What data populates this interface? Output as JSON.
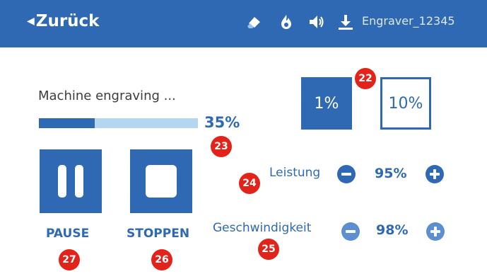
{
  "header": {
    "back_label": "Zurück",
    "device_name": "Engraver_12345",
    "icons": [
      "eraser-icon",
      "flame-icon",
      "speaker-icon",
      "download-icon"
    ]
  },
  "job": {
    "status": "Machine engraving ...",
    "progress_percent": 35,
    "progress_label": "35%"
  },
  "controls": {
    "pause_label": "PAUSE",
    "stop_label": "STOPPEN"
  },
  "step": {
    "small_label": "1%",
    "large_label": "10%"
  },
  "params": {
    "power": {
      "label": "Leistung",
      "value": "95%"
    },
    "speed": {
      "label": "Geschwindigkeit",
      "value": "98%"
    }
  },
  "markers": {
    "m22": "22",
    "m23": "23",
    "m24": "24",
    "m25": "25",
    "m26": "26",
    "m27": "27"
  },
  "colors": {
    "primary": "#2f69b3",
    "track": "#b4d6f0",
    "marker": "#e2231a"
  }
}
